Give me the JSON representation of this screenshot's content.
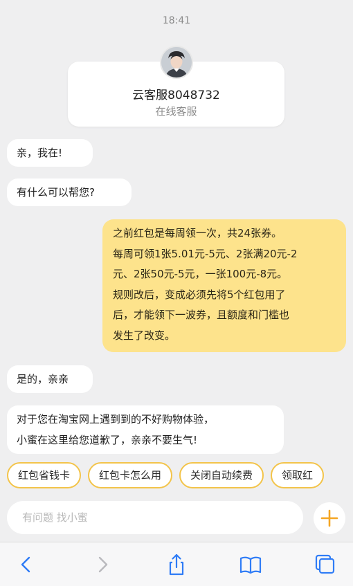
{
  "status": {
    "time": "18:41"
  },
  "agent": {
    "name": "云客服8048732",
    "role": "在线客服"
  },
  "messages": [
    {
      "from": "agent",
      "text": "亲，我在!"
    },
    {
      "from": "agent",
      "text": "有什么可以帮您?"
    },
    {
      "from": "user",
      "lines": [
        "之前红包是每周领一次，共24张券。",
        "每周可领1张5.01元-5元、2张满20元-2",
        "元、2张50元-5元，一张100元-8元。",
        "规则改后，变成必须先将5个红包用了",
        "后，才能领下一波券，且额度和门槛也",
        "发生了改变。"
      ]
    },
    {
      "from": "agent",
      "text": "是的，亲亲"
    },
    {
      "from": "agent",
      "lines": [
        "对于您在淘宝网上遇到到的不好购物体验，",
        "小蜜在这里给您道歉了，亲亲不要生气!"
      ]
    }
  ],
  "quick_replies": [
    "红包省钱卡",
    "红包卡怎么用",
    "关闭自动续费",
    "领取红"
  ],
  "composer": {
    "placeholder": "有问题 找小蜜"
  },
  "icons": {
    "plus": "plus-icon",
    "back": "chevron-left-icon",
    "forward": "chevron-right-icon",
    "share": "share-icon",
    "bookmarks": "book-icon",
    "tabs": "tabs-icon"
  },
  "colors": {
    "background": "#efeff0",
    "user_bubble": "#fde38c",
    "chip_border": "#f3c44a",
    "accent": "#f5a623",
    "link_blue": "#2f7cf6"
  }
}
